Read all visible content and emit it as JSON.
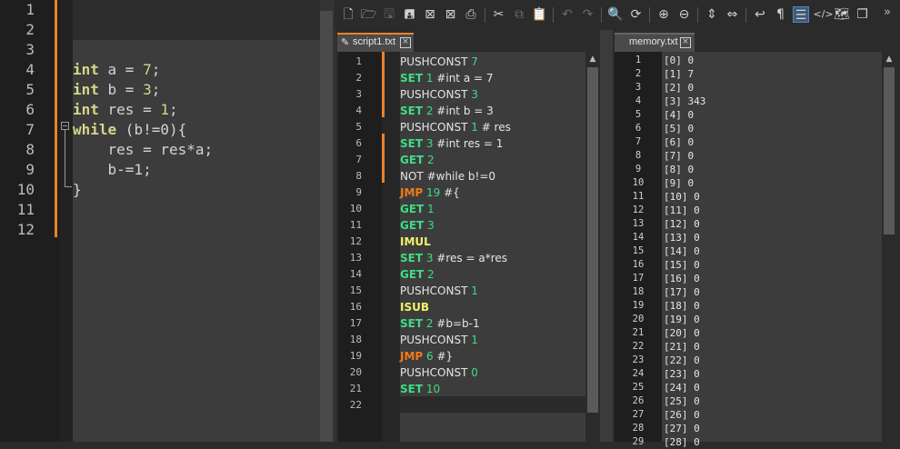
{
  "left_editor": {
    "line_numbers": [
      "1",
      "2",
      "3",
      "4",
      "5",
      "6",
      "7",
      "8",
      "9",
      "10",
      "11",
      "12"
    ],
    "lines": [
      {
        "type": "decl",
        "kw": "int",
        "rest": " a = ",
        "num": "7",
        ";": ";"
      },
      {
        "type": "decl",
        "kw": "int",
        "rest": " b = ",
        "num": "3",
        ";": ";"
      },
      {
        "type": "decl",
        "kw": "int",
        "rest": " res = ",
        "num": "1",
        ";": ";"
      },
      {
        "type": "while",
        "kw": "while",
        "rest": " (b!=0){"
      },
      {
        "type": "plain",
        "text": "    res = res*a;"
      },
      {
        "type": "plain",
        "text": "    b-=1;"
      },
      {
        "type": "plain",
        "text": "}"
      }
    ]
  },
  "toolbar": {
    "icons": [
      "new-file-icon",
      "open-file-icon",
      "save-icon",
      "save-all-icon",
      "close-icon",
      "close-all-icon",
      "print-icon",
      "cut-icon",
      "copy-icon",
      "paste-icon",
      "undo-icon",
      "redo-icon",
      "find-icon",
      "replace-icon",
      "zoom-in-icon",
      "zoom-out-icon",
      "sync-vertical-icon",
      "sync-horizontal-icon",
      "word-wrap-icon",
      "show-all-chars-icon",
      "indent-guide-icon",
      "xml-icon",
      "map-icon",
      "clone-icon"
    ],
    "more": "»"
  },
  "script_tab": {
    "label": "script1.txt",
    "close": "×"
  },
  "memory_tab": {
    "label": "memory.txt",
    "close": "×"
  },
  "script_lines": [
    {
      "n": "1",
      "op": "PUSHCONST",
      "arg": " 7",
      "cls": "white"
    },
    {
      "n": "2",
      "op": "SET",
      "arg": " 1",
      "comment": " #int a = 7",
      "cls": "green"
    },
    {
      "n": "3",
      "op": "PUSHCONST",
      "arg": " 3",
      "cls": "white"
    },
    {
      "n": "4",
      "op": "SET",
      "arg": " 2",
      "comment": " #int b = 3",
      "cls": "green"
    },
    {
      "n": "5",
      "op": "PUSHCONST",
      "arg": " 1",
      "comment": " # res",
      "cls": "white"
    },
    {
      "n": "6",
      "op": "SET",
      "arg": " 3",
      "comment": " #int res = 1",
      "cls": "green"
    },
    {
      "n": "7",
      "op": "GET",
      "arg": " 2",
      "cls": "green"
    },
    {
      "n": "8",
      "op": "NOT",
      "arg": "",
      "comment": " #while b!=0",
      "cls": "white"
    },
    {
      "n": "9",
      "op": "JMP",
      "arg": " 19",
      "comment": " #{",
      "cls": "orange"
    },
    {
      "n": "10",
      "op": "GET",
      "arg": " 1",
      "cls": "green"
    },
    {
      "n": "11",
      "op": "GET",
      "arg": " 3",
      "cls": "green"
    },
    {
      "n": "12",
      "op": "IMUL",
      "arg": "",
      "cls": "yellow"
    },
    {
      "n": "13",
      "op": "SET",
      "arg": " 3",
      "comment": " #res = a*res",
      "cls": "green"
    },
    {
      "n": "14",
      "op": "GET",
      "arg": " 2",
      "cls": "green"
    },
    {
      "n": "15",
      "op": "PUSHCONST",
      "arg": " 1",
      "cls": "white"
    },
    {
      "n": "16",
      "op": "ISUB",
      "arg": "",
      "cls": "yellow"
    },
    {
      "n": "17",
      "op": "SET",
      "arg": " 2",
      "comment": " #b=b-1",
      "cls": "green"
    },
    {
      "n": "18",
      "op": "PUSHCONST",
      "arg": " 1",
      "cls": "white"
    },
    {
      "n": "19",
      "op": "JMP",
      "arg": " 6",
      "comment": " #}",
      "cls": "orange"
    },
    {
      "n": "20",
      "op": "PUSHCONST",
      "arg": " 0",
      "cls": "white"
    },
    {
      "n": "21",
      "op": "SET",
      "arg": " 10",
      "cls": "green"
    },
    {
      "n": "22",
      "op": "",
      "arg": "",
      "cls": "white"
    }
  ],
  "memory_lines": [
    [
      "1",
      "[0] 0"
    ],
    [
      "2",
      "[1] 7"
    ],
    [
      "3",
      "[2] 0"
    ],
    [
      "4",
      "[3] 343"
    ],
    [
      "5",
      "[4] 0"
    ],
    [
      "6",
      "[5] 0"
    ],
    [
      "7",
      "[6] 0"
    ],
    [
      "8",
      "[7] 0"
    ],
    [
      "9",
      "[8] 0"
    ],
    [
      "10",
      "[9] 0"
    ],
    [
      "11",
      "[10] 0"
    ],
    [
      "12",
      "[11] 0"
    ],
    [
      "13",
      "[12] 0"
    ],
    [
      "14",
      "[13] 0"
    ],
    [
      "15",
      "[14] 0"
    ],
    [
      "16",
      "[15] 0"
    ],
    [
      "17",
      "[16] 0"
    ],
    [
      "18",
      "[17] 0"
    ],
    [
      "19",
      "[18] 0"
    ],
    [
      "20",
      "[19] 0"
    ],
    [
      "21",
      "[20] 0"
    ],
    [
      "22",
      "[21] 0"
    ],
    [
      "23",
      "[22] 0"
    ],
    [
      "24",
      "[23] 0"
    ],
    [
      "25",
      "[24] 0"
    ],
    [
      "26",
      "[25] 0"
    ],
    [
      "27",
      "[26] 0"
    ],
    [
      "28",
      "[27] 0"
    ],
    [
      "29",
      "[28] 0"
    ]
  ],
  "colors": {
    "accent": "#e8832a",
    "green": "#3fdc84",
    "orange": "#f07a1a",
    "yellow": "#f2f26a"
  }
}
